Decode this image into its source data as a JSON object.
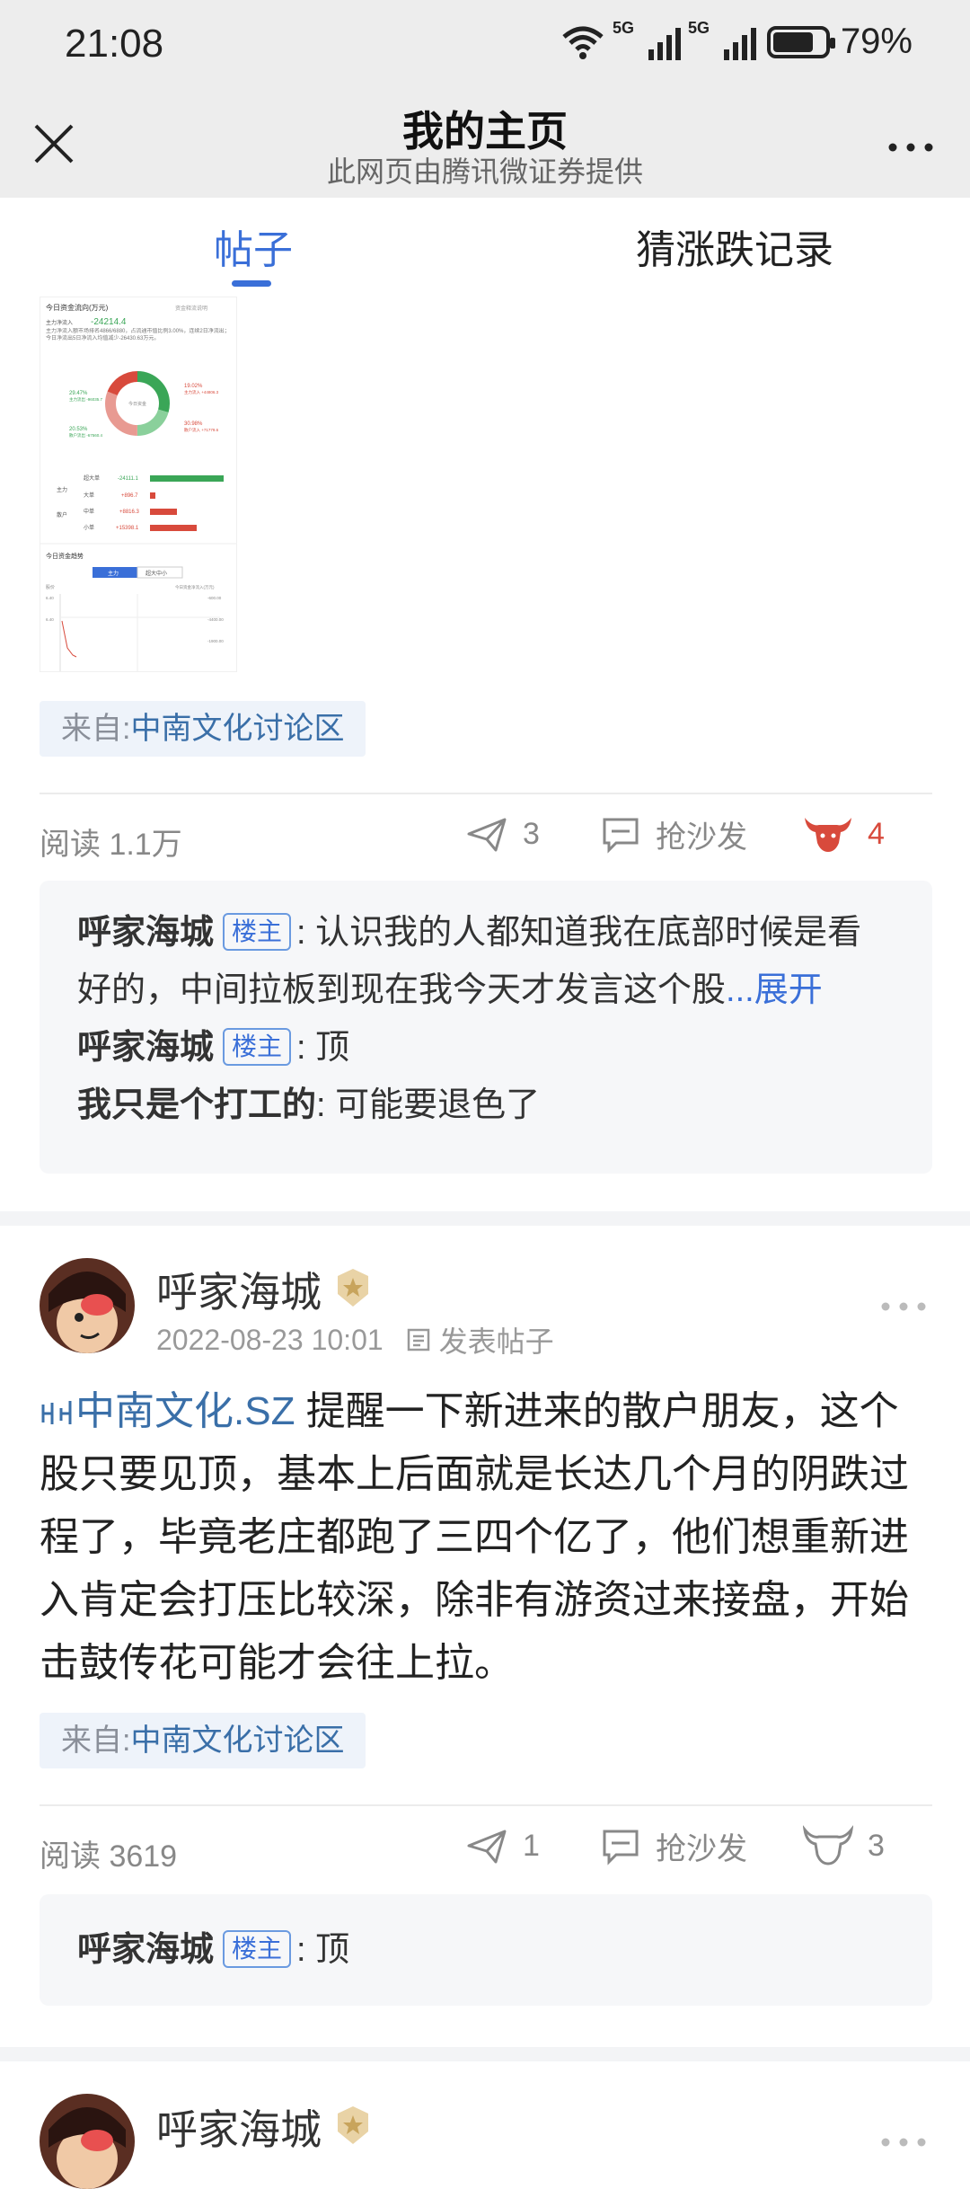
{
  "status": {
    "time": "21:08",
    "signal1": "5G",
    "signal2": "5G",
    "battery": "79%"
  },
  "nav": {
    "title": "我的主页",
    "subtitle": "此网页由腾讯微证券提供"
  },
  "tabs": [
    {
      "label": "帖子"
    },
    {
      "label": "猜涨跌记录"
    }
  ],
  "post1": {
    "image": {
      "title": "今日资金流向(万元)",
      "note": "资金释流说明",
      "main_inflow_label": "主力净流入",
      "main_inflow": "-24214.4",
      "desc": "主力净流入额市场排名4866/6880，占流通市值比例3.00%，连续2日净流出；今日净流出5日净流入均值减少-26430.63万元。",
      "pie_center": "今日资金",
      "pie_labels": [
        "29.47%",
        "19.02%",
        "20.53%",
        "30.98%"
      ],
      "pie_sub": [
        "主力流出 -96035.7",
        "主力流入 +44806.3",
        "散户流出 -67560.4",
        "散户流入 +71779.6"
      ],
      "rows": [
        {
          "group": "主力",
          "name": "超大单",
          "value": "-24111.1"
        },
        {
          "group": "",
          "name": "大单",
          "value": "+896.7"
        },
        {
          "group": "散户",
          "name": "中单",
          "value": "+8816.3"
        },
        {
          "group": "",
          "name": "小单",
          "value": "+15398.1"
        }
      ],
      "trend_title": "今日资金趋势",
      "trend_tabs": [
        "主力",
        "超大中小"
      ],
      "trend_axis": "股价",
      "trend_right": "今日资金净流入(万元)",
      "trend_ticks_left": [
        "6.40",
        "6.40"
      ],
      "trend_ticks_right": [
        "-600.00",
        "-4400.00",
        "-1900.00"
      ]
    },
    "source_prefix": "来自:",
    "source_name": "中南文化讨论区",
    "read": "阅读 1.1万",
    "share_count": "3",
    "comment_label": "抢沙发",
    "bull_count": "4",
    "comments": [
      {
        "user": "呼家海城",
        "badge": "楼主",
        "text": ": 认识我的人都知道我在底部时候是看好的，中间拉板到现在我今天才发言这个股",
        "expand": "...展开"
      },
      {
        "user": "呼家海城",
        "badge": "楼主",
        "text": ": 顶"
      },
      {
        "user": "我只是个打工的",
        "text": ": 可能要退色了"
      }
    ]
  },
  "post2": {
    "user": "呼家海城",
    "time": "2022-08-23 10:01",
    "type_label": "发表帖子",
    "stock_link": "中南文化.SZ",
    "body": "提醒一下新进来的散户朋友，这个股只要见顶，基本上后面就是长达几个月的阴跌过程了，毕竟老庄都跑了三四个亿了，他们想重新进入肯定会打压比较深，除非有游资过来接盘，开始击鼓传花可能才会往上拉。",
    "source_prefix": "来自:",
    "source_name": "中南文化讨论区",
    "read": "阅读 3619",
    "share_count": "1",
    "comment_label": "抢沙发",
    "bull_count": "3",
    "comments": [
      {
        "user": "呼家海城",
        "badge": "楼主",
        "text": ": 顶"
      }
    ]
  },
  "post3": {
    "user": "呼家海城"
  },
  "colors": {
    "accent": "#3a6fd8",
    "bull_red": "#d84a3c",
    "positive_red": "#d84a3c",
    "negative_green": "#3aa657"
  }
}
